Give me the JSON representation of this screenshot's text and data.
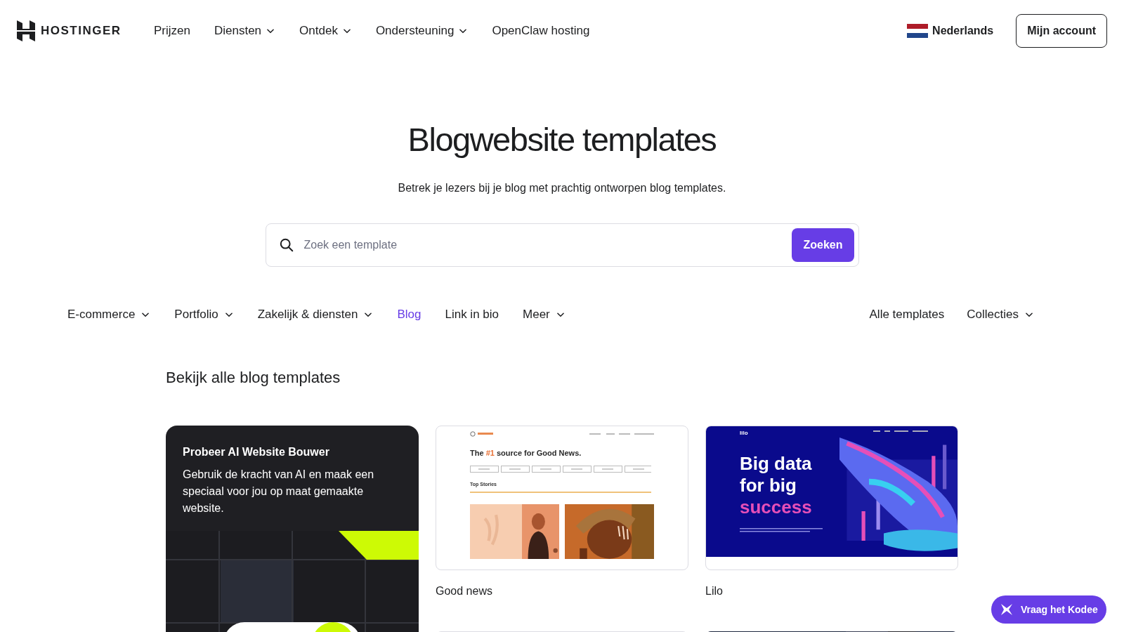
{
  "header": {
    "brand": "HOSTINGER",
    "nav": [
      {
        "label": "Prijzen",
        "dropdown": false
      },
      {
        "label": "Diensten",
        "dropdown": true
      },
      {
        "label": "Ontdek",
        "dropdown": true
      },
      {
        "label": "Ondersteuning",
        "dropdown": true
      },
      {
        "label": "OpenClaw hosting",
        "dropdown": false
      }
    ],
    "language": "Nederlands",
    "account_button": "Mijn account"
  },
  "hero": {
    "title": "Blogwebsite templates",
    "subtitle": "Betrek je lezers bij je blog met prachtig ontworpen blog templates.",
    "search": {
      "placeholder": "Zoek een template",
      "button": "Zoeken"
    }
  },
  "categories": [
    {
      "label": "E-commerce",
      "dropdown": true,
      "selected": false
    },
    {
      "label": "Portfolio",
      "dropdown": true,
      "selected": false
    },
    {
      "label": "Zakelijk & diensten",
      "dropdown": true,
      "selected": false
    },
    {
      "label": "Blog",
      "dropdown": false,
      "selected": true
    },
    {
      "label": "Link in bio",
      "dropdown": false,
      "selected": false
    },
    {
      "label": "Meer",
      "dropdown": true,
      "selected": false
    }
  ],
  "right_links": [
    {
      "label": "Alle templates",
      "dropdown": false
    },
    {
      "label": "Collecties",
      "dropdown": true
    }
  ],
  "section_title": "Bekijk alle blog templates",
  "promo": {
    "title": "Probeer AI Website Bouwer",
    "text": "Gebruik de kracht van AI en maak een speciaal voor jou op maat gemaakte website."
  },
  "templates": [
    {
      "kind": "news",
      "name": "Good news",
      "headline": {
        "before": "The",
        "accent": "#1",
        "after": "source for Good News."
      },
      "section": "Top Stories"
    },
    {
      "kind": "tech",
      "name": "Lilo",
      "logo": "lilo",
      "headline": {
        "lines": [
          "Big data",
          "for big"
        ],
        "accent": "success"
      }
    },
    {
      "kind": "plain"
    },
    {
      "kind": "dark"
    }
  ],
  "chat_button": "Vraag het Kodee"
}
